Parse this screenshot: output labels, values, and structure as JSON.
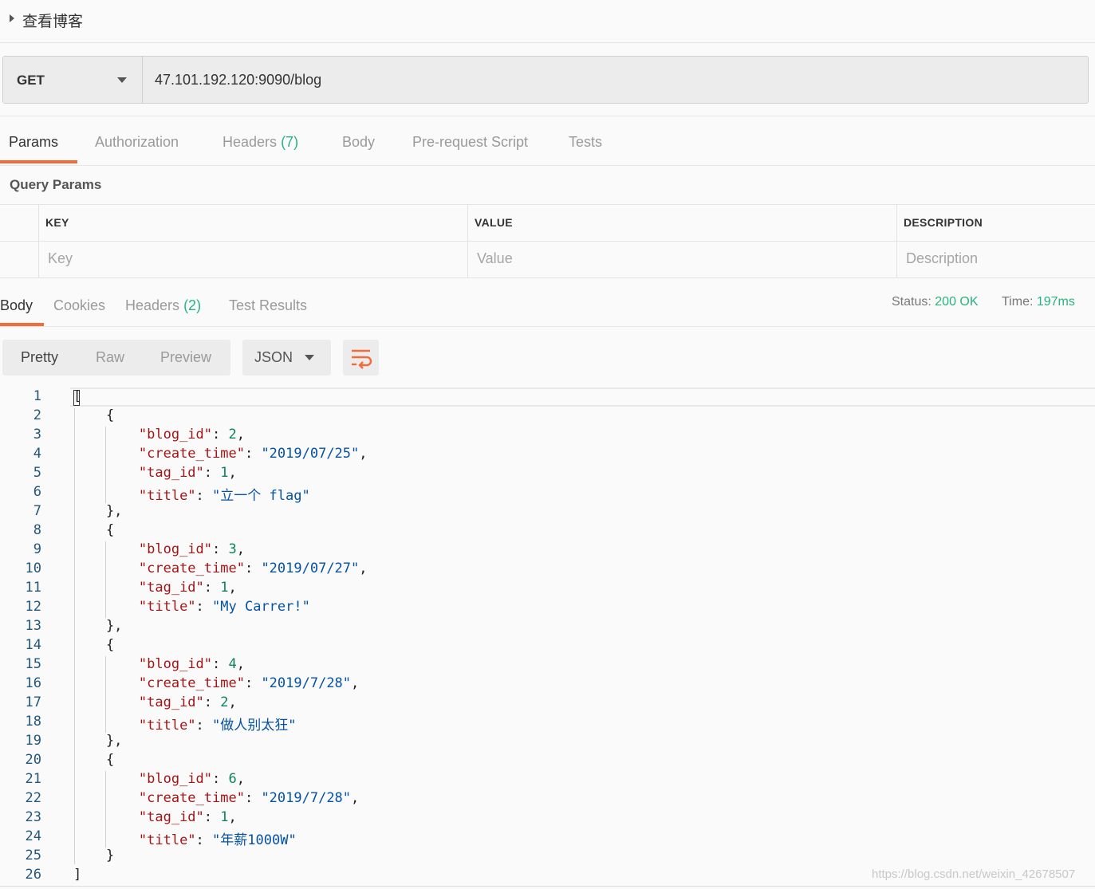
{
  "request": {
    "name": "查看博客",
    "method": "GET",
    "url": "47.101.192.120:9090/blog"
  },
  "request_tabs": [
    {
      "label": "Params",
      "active": true
    },
    {
      "label": "Authorization"
    },
    {
      "label": "Headers",
      "count": "(7)"
    },
    {
      "label": "Body"
    },
    {
      "label": "Pre-request Script"
    },
    {
      "label": "Tests"
    }
  ],
  "query_params": {
    "title": "Query Params",
    "columns": [
      "KEY",
      "VALUE",
      "DESCRIPTION"
    ],
    "placeholders": [
      "Key",
      "Value",
      "Description"
    ]
  },
  "response_tabs": [
    {
      "label": "Body",
      "active": true
    },
    {
      "label": "Cookies"
    },
    {
      "label": "Headers",
      "count": "(2)"
    },
    {
      "label": "Test Results"
    }
  ],
  "status": {
    "status_label": "Status:",
    "status_value": "200 OK",
    "time_label": "Time:",
    "time_value": "197ms"
  },
  "view_tabs": [
    {
      "label": "Pretty",
      "active": true
    },
    {
      "label": "Raw"
    },
    {
      "label": "Preview"
    }
  ],
  "format": "JSON",
  "colors": {
    "accent": "#f26b3a",
    "success": "#26b47f",
    "json_key": "#a31515",
    "json_string": "#0451a5",
    "json_number": "#098658"
  },
  "response_body": [
    {
      "blog_id": 2,
      "create_time": "2019/07/25",
      "tag_id": 1,
      "title": "立一个 flag"
    },
    {
      "blog_id": 3,
      "create_time": "2019/07/27",
      "tag_id": 1,
      "title": "My Carrer!"
    },
    {
      "blog_id": 4,
      "create_time": "2019/7/28",
      "tag_id": 2,
      "title": "做人别太狂"
    },
    {
      "blog_id": 6,
      "create_time": "2019/7/28",
      "tag_id": 1,
      "title": "年薪1000W"
    }
  ],
  "watermark": "https://blog.csdn.net/weixin_42678507"
}
